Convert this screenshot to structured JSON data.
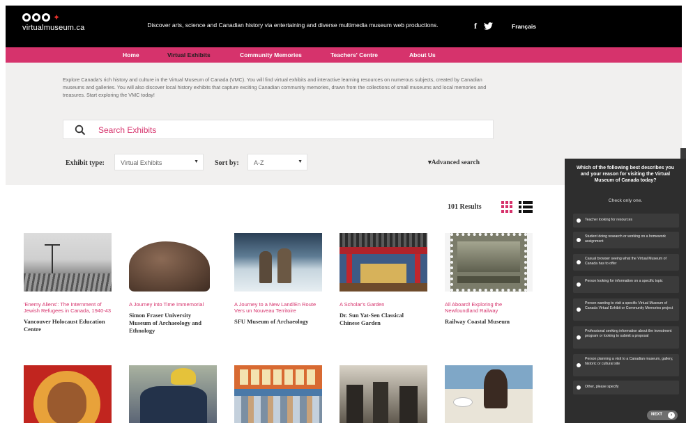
{
  "header": {
    "logo_text": "virtualmuseum.ca",
    "tagline": "Discover arts, science and Canadian history via entertaining and diverse multimedia museum web productions.",
    "social": [
      "f",
      "twitter"
    ],
    "language": "Français"
  },
  "nav": {
    "items": [
      {
        "label": "Home"
      },
      {
        "label": "Virtual Exhibits",
        "active": true
      },
      {
        "label": "Community Memories"
      },
      {
        "label": "Teachers' Centre"
      },
      {
        "label": "About Us"
      }
    ]
  },
  "intro": {
    "text": "Explore Canada's rich history and culture in the Virtual Museum of Canada (VMC). You will find virtual exhibits and interactive learning resources on numerous subjects, created by Canadian museums and galleries. You will also discover local history exhibits that capture exciting Canadian community memories, drawn from the collections of small museums and local memories and treasures. Start exploring the VMC today!"
  },
  "search": {
    "placeholder": "Search Exhibits"
  },
  "filters": {
    "exhibit_type_label": "Exhibit type:",
    "exhibit_type_value": "Virtual Exhibits",
    "sort_label": "Sort by:",
    "sort_value": "A-Z",
    "advanced_search": "▾Advanced search"
  },
  "results": {
    "count": "101 Results"
  },
  "cards": [
    {
      "title": "'Enemy Aliens': The Internment of Jewish Refugees in Canada, 1940-43",
      "org": "Vancouver Holocaust Education Centre"
    },
    {
      "title": "A Journey into Time Immemorial",
      "org": "Simon Fraser University Museum of Archaeology and Ethnology"
    },
    {
      "title": "A Journey to a New Land/En Route Vers un Nouveau Territoire",
      "org": "SFU Museum of Archaeology"
    },
    {
      "title": "A Scholar's Garden",
      "org": "Dr. Sun Yat-Sen Classical Chinese Garden"
    },
    {
      "title": "All Aboard! Exploring the Newfoundland Railway",
      "org": "Railway Coastal Museum"
    }
  ],
  "survey": {
    "question": "Which of the following best describes you and your reason for visiting the Virtual Museum of Canada today?",
    "instruction": "Check only one.",
    "options": [
      "Teacher looking for resources",
      "Student doing research or working on a homework assignment",
      "Casual browser seeing what the Virtual Museum of Canada has to offer",
      "Person looking for information on a specific topic",
      "Person wanting to visit a specific Virtual Museum of Canada Virtual Exhibit or Community Memories project",
      "Professional seeking information about the investment program or looking to submit a proposal",
      "Person planning a visit to a Canadian museum, gallery, historic or cultural site",
      "Other, please specify"
    ],
    "next_label": "NEXT",
    "next_icon": "›"
  },
  "colors": {
    "brand_pink": "#d6336c",
    "header_black": "#000000",
    "intro_grey": "#f1f0ef",
    "survey_dark": "#2e2e2e"
  }
}
